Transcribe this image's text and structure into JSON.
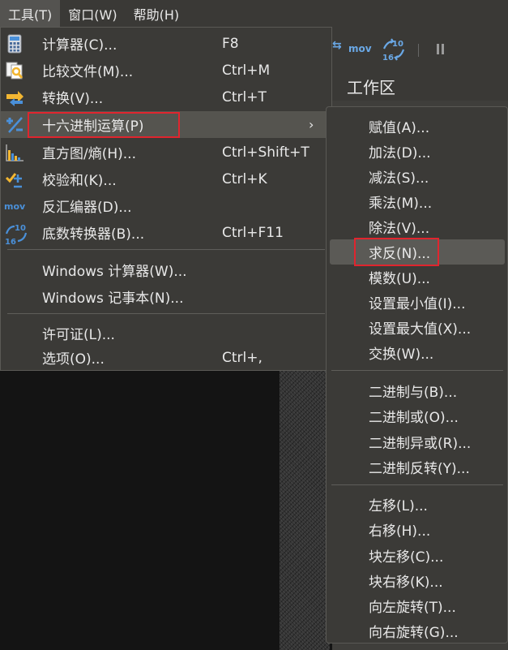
{
  "menubar": {
    "items": [
      {
        "label": "工具(T)",
        "active": true
      },
      {
        "label": "窗口(W)",
        "active": false
      },
      {
        "label": "帮助(H)",
        "active": false
      }
    ]
  },
  "background": {
    "workspace_title": "工作区",
    "toolbar_mov": "mov",
    "toolbar_1016_top": "10",
    "toolbar_1016_bottom": "16"
  },
  "tools_menu": {
    "items": [
      {
        "label": "计算器(C)...",
        "shortcut": "F8",
        "icon": "calculator-icon"
      },
      {
        "label": "比较文件(M)...",
        "shortcut": "Ctrl+M",
        "icon": "compare-files-icon"
      },
      {
        "label": "转换(V)...",
        "shortcut": "Ctrl+T",
        "icon": "convert-icon"
      },
      {
        "label": "十六进制运算(P)",
        "shortcut": "",
        "icon": "hex-operations-icon",
        "submenu": true
      },
      {
        "label": "直方图/熵(H)...",
        "shortcut": "Ctrl+Shift+T",
        "icon": "histogram-icon"
      },
      {
        "label": "校验和(K)...",
        "shortcut": "Ctrl+K",
        "icon": "checksum-icon"
      },
      {
        "label": "反汇编器(D)...",
        "shortcut": "",
        "icon": "disassembler-icon"
      },
      {
        "label": "底数转换器(B)...",
        "shortcut": "Ctrl+F11",
        "icon": "base-converter-icon"
      },
      {
        "label": "Windows 计算器(W)...",
        "shortcut": ""
      },
      {
        "label": "Windows 记事本(N)...",
        "shortcut": ""
      },
      {
        "label": "许可证(L)...",
        "shortcut": ""
      },
      {
        "label": "选项(O)...",
        "shortcut": "Ctrl+,"
      }
    ],
    "submenu_arrow": "›",
    "icon_mov_text": "mov",
    "icon_1016_top": "10",
    "icon_1016_bottom": "16"
  },
  "hex_submenu": {
    "items": [
      {
        "label": "赋值(A)..."
      },
      {
        "label": "加法(D)..."
      },
      {
        "label": "减法(S)..."
      },
      {
        "label": "乘法(M)..."
      },
      {
        "label": "除法(V)..."
      },
      {
        "label": "求反(N)...",
        "highlighted": true
      },
      {
        "label": "模数(U)..."
      },
      {
        "label": "设置最小值(I)..."
      },
      {
        "label": "设置最大值(X)..."
      },
      {
        "label": "交换(W)..."
      },
      {
        "label": "二进制与(B)..."
      },
      {
        "label": "二进制或(O)..."
      },
      {
        "label": "二进制异或(R)..."
      },
      {
        "label": "二进制反转(Y)..."
      },
      {
        "label": "左移(L)..."
      },
      {
        "label": "右移(H)..."
      },
      {
        "label": "块左移(C)..."
      },
      {
        "label": "块右移(K)..."
      },
      {
        "label": "向左旋转(T)..."
      },
      {
        "label": "向右旋转(G)..."
      }
    ]
  },
  "colors": {
    "menu_bg": "#3b3a37",
    "highlight": "#55544f",
    "annotation_red": "#e0252e",
    "icon_blue": "#4a90d9",
    "icon_yellow": "#f2b632"
  }
}
